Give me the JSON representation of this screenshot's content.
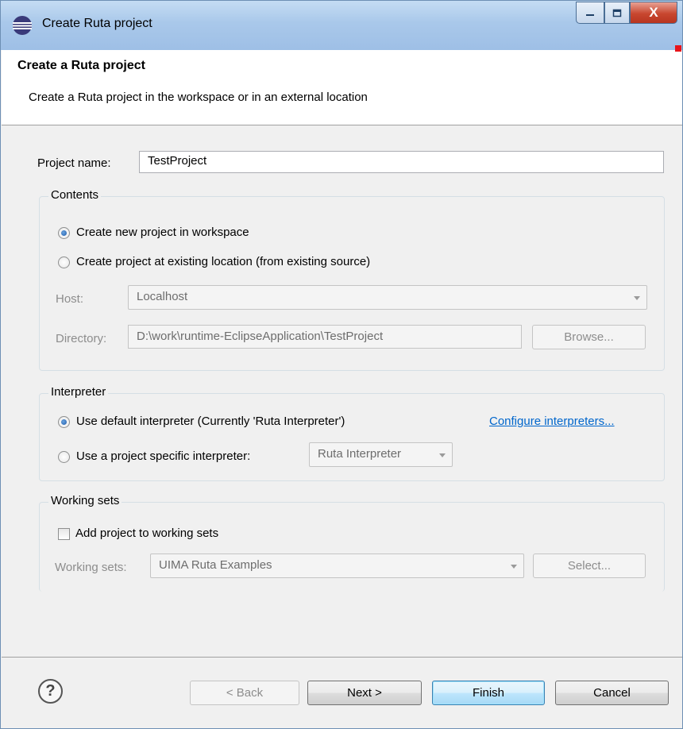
{
  "window": {
    "title": "Create Ruta project",
    "controls": {
      "minimize": "–",
      "maximize": "□",
      "close": "X"
    }
  },
  "header": {
    "title": "Create a Ruta project",
    "description": "Create a Ruta project in the workspace or in an external location"
  },
  "project_name": {
    "label": "Project name:",
    "value": "TestProject"
  },
  "contents": {
    "title": "Contents",
    "option_new": "Create new project in workspace",
    "option_existing": "Create project at existing location (from existing source)",
    "selected": "option_new",
    "host_label": "Host:",
    "host_value": "Localhost",
    "directory_label": "Directory:",
    "directory_value": "D:\\work\\runtime-EclipseApplication\\TestProject",
    "browse_label": "Browse..."
  },
  "interpreter": {
    "title": "Interpreter",
    "option_default": "Use default interpreter (Currently 'Ruta Interpreter')",
    "option_specific": "Use a project specific interpreter:",
    "selected": "option_default",
    "configure_link": "Configure interpreters...",
    "specific_value": "Ruta Interpreter"
  },
  "working_sets": {
    "title": "Working sets",
    "add_label": "Add project to working sets",
    "add_checked": false,
    "sets_label": "Working sets:",
    "sets_value": "UIMA Ruta Examples",
    "select_label": "Select..."
  },
  "footer": {
    "help_icon": "question-mark",
    "back_label": "< Back",
    "next_label": "Next >",
    "finish_label": "Finish",
    "cancel_label": "Cancel"
  },
  "colors": {
    "accent_link": "#0066cc",
    "close_button": "#c8472f",
    "title_gradient": "#a9c8ea"
  }
}
